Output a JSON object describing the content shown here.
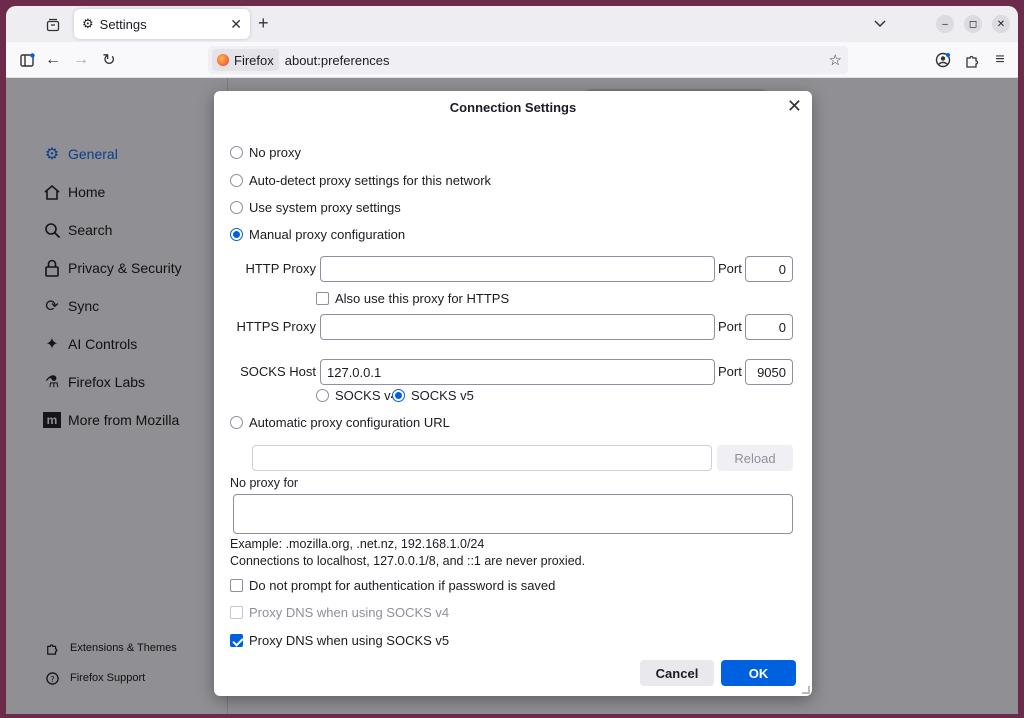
{
  "browser": {
    "tab_title": "Settings",
    "identity_label": "Firefox",
    "url": "about:preferences"
  },
  "sidebar": {
    "items": [
      {
        "label": "General",
        "icon": "gear-icon"
      },
      {
        "label": "Home",
        "icon": "home-icon"
      },
      {
        "label": "Search",
        "icon": "search-icon"
      },
      {
        "label": "Privacy & Security",
        "icon": "lock-icon"
      },
      {
        "label": "Sync",
        "icon": "sync-icon"
      },
      {
        "label": "AI Controls",
        "icon": "sparkle-icon"
      },
      {
        "label": "Firefox Labs",
        "icon": "labs-icon"
      },
      {
        "label": "More from Mozilla",
        "icon": "mozilla-icon"
      }
    ],
    "footer": [
      {
        "label": "Extensions & Themes",
        "icon": "puzzle-icon"
      },
      {
        "label": "Firefox Support",
        "icon": "help-icon"
      }
    ]
  },
  "dialog": {
    "title": "Connection Settings",
    "options": {
      "no_proxy": "No proxy",
      "auto_detect": "Auto-detect proxy settings for this network",
      "system": "Use system proxy settings",
      "manual": "Manual proxy configuration",
      "auto_url": "Automatic proxy configuration URL"
    },
    "selected_option": "manual",
    "http_proxy": {
      "label": "HTTP Proxy",
      "value": "",
      "port_label": "Port",
      "port": "0"
    },
    "also_https": "Also use this proxy for HTTPS",
    "https_proxy": {
      "label": "HTTPS Proxy",
      "value": "",
      "port_label": "Port",
      "port": "0"
    },
    "socks_host": {
      "label": "SOCKS Host",
      "value": "127.0.0.1",
      "port_label": "Port",
      "port": "9050"
    },
    "socks_v4": "SOCKS v4",
    "socks_v5": "SOCKS v5",
    "socks_selected": "v5",
    "auto_url_value": "",
    "reload_label": "Reload",
    "no_proxy_for_label": "No proxy for",
    "no_proxy_for_value": "",
    "example_text": "Example: .mozilla.org, .net.nz, 192.168.1.0/24",
    "localhost_note": "Connections to localhost, 127.0.0.1/8, and ::1 are never proxied.",
    "no_prompt_auth": "Do not prompt for authentication if password is saved",
    "dns_socks4": "Proxy DNS when using SOCKS v4",
    "dns_socks5": "Proxy DNS when using SOCKS v5",
    "cancel_label": "Cancel",
    "ok_label": "OK"
  },
  "colors": {
    "accent": "#0061e0",
    "frame": "#6b2b4a"
  }
}
